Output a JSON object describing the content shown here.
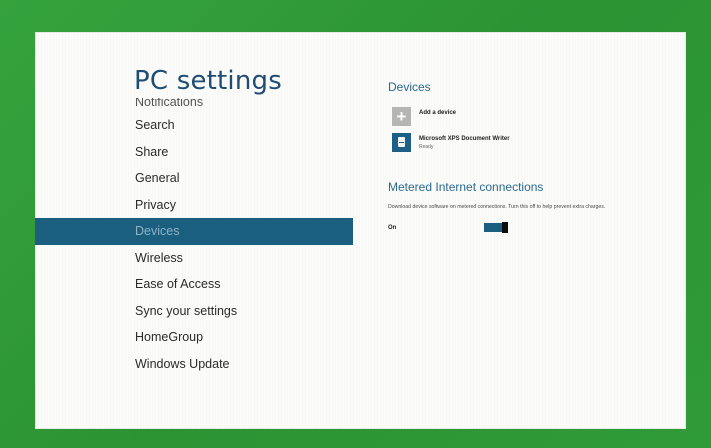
{
  "settings": {
    "title": "PC settings",
    "nav_items": [
      {
        "label": "Notifications",
        "partial": true
      },
      {
        "label": "Search"
      },
      {
        "label": "Share"
      },
      {
        "label": "General"
      },
      {
        "label": "Privacy"
      },
      {
        "label": "Devices",
        "selected": true
      },
      {
        "label": "Wireless"
      },
      {
        "label": "Ease of Access"
      },
      {
        "label": "Sync your settings"
      },
      {
        "label": "HomeGroup"
      },
      {
        "label": "Windows Update"
      }
    ]
  },
  "devices": {
    "title": "Devices",
    "add_device": {
      "label": "Add a device",
      "icon": "plus-icon"
    },
    "items": [
      {
        "name": "Microsoft XPS Document Writer",
        "status": "Ready",
        "icon": "printer-icon"
      }
    ]
  },
  "metered": {
    "title": "Metered Internet connections",
    "description": "Download device software on metered connections. Turn this off to help prevent extra charges.",
    "toggle_state": "On"
  },
  "colors": {
    "frame_green": "#2f9a36",
    "accent": "#1b5f80",
    "title_blue": "#1f4d73",
    "selected_text": "#8fb3c6"
  }
}
